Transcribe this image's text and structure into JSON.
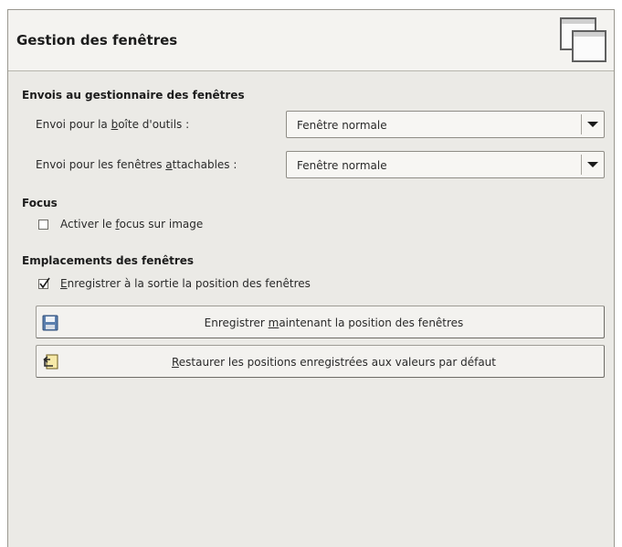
{
  "header": {
    "title": "Gestion des fenêtres",
    "icon": "window-management-icon"
  },
  "sections": {
    "hints": {
      "title": "Envois au gestionnaire des fenêtres",
      "toolbox": {
        "label_pre": "Envoi pour la ",
        "label_mnemonic": "b",
        "label_post": "oîte d'outils :",
        "value": "Fenêtre normale"
      },
      "docks": {
        "label_pre": "Envoi pour les fenêtres ",
        "label_mnemonic": "a",
        "label_post": "ttachables :",
        "value": "Fenêtre normale"
      }
    },
    "focus": {
      "title": "Focus",
      "activate": {
        "label_pre": "Activer le ",
        "label_mnemonic": "f",
        "label_post": "ocus sur image",
        "checked": false
      }
    },
    "positions": {
      "title": "Emplacements des fenêtres",
      "save_on_exit": {
        "label_pre": "",
        "label_mnemonic": "E",
        "label_post": "nregistrer à la sortie la position des fenêtres",
        "checked": true
      },
      "save_now": {
        "label_pre": "Enregistrer ",
        "label_mnemonic": "m",
        "label_post": "aintenant la position des fenêtres",
        "icon": "floppy-disk-icon"
      },
      "reset": {
        "label_pre": "",
        "label_mnemonic": "R",
        "label_post": "estaurer les positions enregistrées aux valeurs par défaut",
        "icon": "revert-icon"
      }
    }
  },
  "colors": {
    "panel_bg": "#ebeae6",
    "header_bg": "#f4f3f0",
    "border": "#9a9890"
  }
}
